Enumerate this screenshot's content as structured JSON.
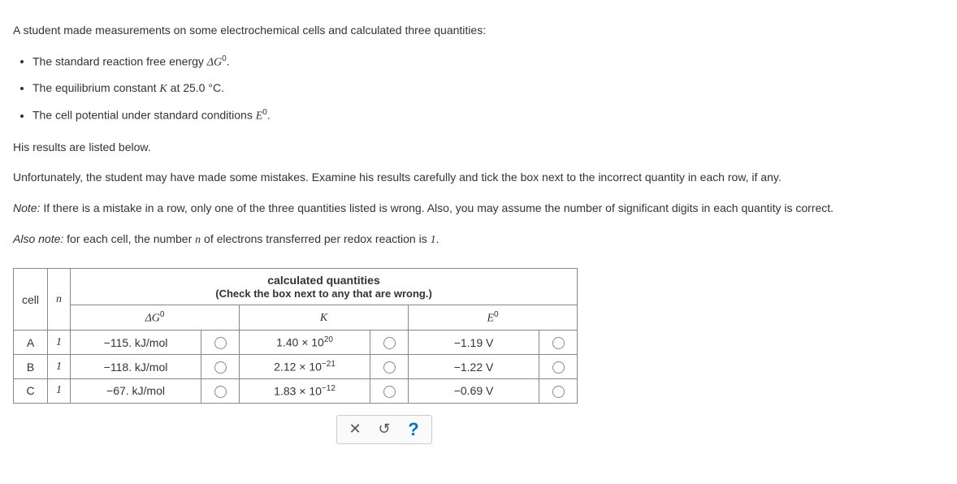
{
  "intro": "A student made measurements on some electrochemical cells and calculated three quantities:",
  "bullets": {
    "b1_pre": "The standard reaction free energy ",
    "b1_sym": "ΔG",
    "b1_sup": "0",
    "b1_post": ".",
    "b2_pre": "The equilibrium constant ",
    "b2_sym": "K",
    "b2_post": " at 25.0 °C.",
    "b3_pre": "The cell potential under standard conditions ",
    "b3_sym": "E",
    "b3_sup": "0",
    "b3_post": "."
  },
  "para1": "His results are listed below.",
  "para2": "Unfortunately, the student may have made some mistakes. Examine his results carefully and tick the box next to the incorrect quantity in each row, if any.",
  "note_label": "Note:",
  "note_body": " If there is a mistake in a row, only one of the three quantities listed is wrong. Also, you may assume the number of significant digits in each quantity is correct.",
  "also_note_label": "Also note:",
  "also_note_body_pre": " for each cell, the number ",
  "also_note_n": "n",
  "also_note_body_mid": " of electrons transferred per redox reaction is ",
  "also_note_one": "1",
  "also_note_body_post": ".",
  "table": {
    "header_calc_title": "calculated quantities",
    "header_calc_sub": "(Check the box next to any that are wrong.)",
    "col_cell": "cell",
    "col_n": "n",
    "col_dg": "ΔG",
    "col_dg_sup": "0",
    "col_k": "K",
    "col_e": "E",
    "col_e_sup": "0",
    "rows": [
      {
        "cell": "A",
        "n": "1",
        "dg": "−115. kJ/mol",
        "k_base": "1.40 × 10",
        "k_exp": "20",
        "e": "−1.19 V"
      },
      {
        "cell": "B",
        "n": "1",
        "dg": "−118. kJ/mol",
        "k_base": "2.12 × 10",
        "k_exp": "−21",
        "e": "−1.22 V"
      },
      {
        "cell": "C",
        "n": "1",
        "dg": "−67. kJ/mol",
        "k_base": "1.83 × 10",
        "k_exp": "−12",
        "e": "−0.69 V"
      }
    ]
  },
  "footer": {
    "close": "✕",
    "reset": "↺",
    "help": "?"
  }
}
